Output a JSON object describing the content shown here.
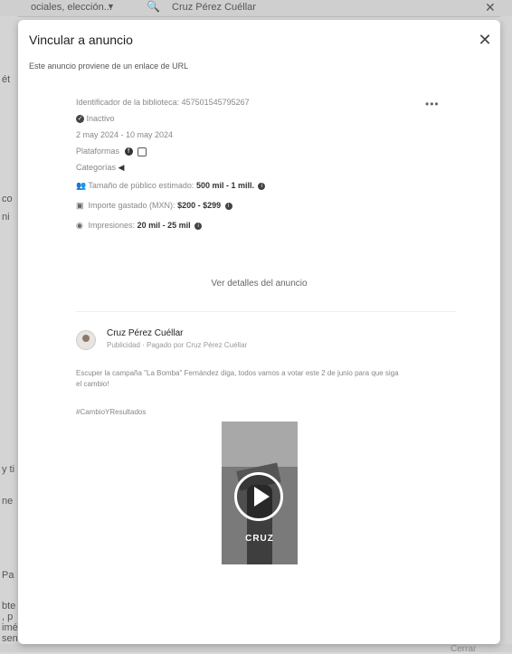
{
  "background": {
    "filter_text": "ociales, elección...",
    "search_text": "Cruz Pérez Cuéllar",
    "left_fragments": [
      "ét",
      "co",
      "ni",
      "y ti",
      "ne",
      "Pa",
      "bte",
      ", p",
      "imé",
      "sen"
    ]
  },
  "modal": {
    "title": "Vincular a anuncio",
    "subtitle": "Este anuncio proviene de un enlace de URL",
    "library_id": "Identificador de la biblioteca: 457501545795267",
    "status": "Inactivo",
    "date_range": "2 may 2024 - 10 may 2024",
    "platforms_label": "Plataformas",
    "categories_label": "Categorías",
    "audience_label": "Tamaño de público estimado:",
    "audience_value": "500 mil - 1 mill.",
    "spend_label": "Importe gastado (MXN):",
    "spend_value": "$200 - $299",
    "impressions_label": "Impresiones:",
    "impressions_value": "20 mil - 25 mil",
    "see_details": "Ver detalles del anuncio",
    "advertiser_name": "Cruz Pérez Cuéllar",
    "advertiser_sub": "Publicidad · Pagado por Cruz Pérez Cuéllar",
    "ad_text": "Escuper la campaña \"La Bomba\" Fernández diga, todos vamos a votar este 2 de junio para que siga el cambio!",
    "hashtag": "#CambioYResultados",
    "video_overlay": "CRUZ",
    "close_label": "Cerrar"
  },
  "icons": {
    "close": "close-icon",
    "more": "more-dots-icon",
    "status": "check-circle-icon",
    "facebook": "facebook-icon",
    "instagram": "instagram-icon",
    "category": "megaphone-icon",
    "audience": "people-icon",
    "spend": "money-icon",
    "impressions": "eye-icon",
    "play": "play-icon"
  }
}
